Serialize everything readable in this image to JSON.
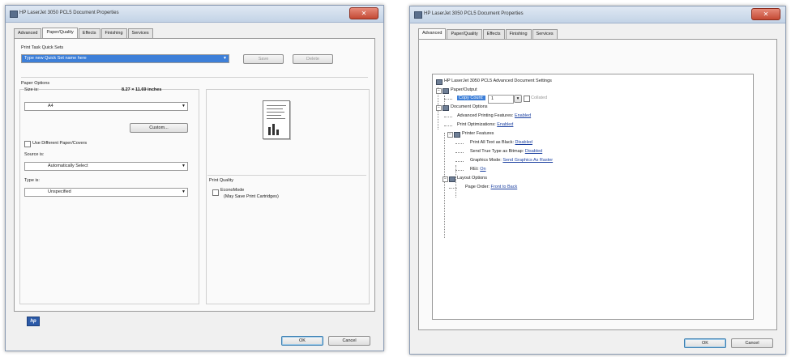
{
  "left_window": {
    "title": "HP LaserJet 3050 PCL5 Document Properties",
    "close_glyph": "✕",
    "tabs": [
      "Advanced",
      "Paper/Quality",
      "Effects",
      "Finishing",
      "Services"
    ],
    "active_tab": "Paper/Quality",
    "print_task_quick_sets": {
      "label": "Print Task Quick Sets",
      "value": "Type new Quick Set name here",
      "save_label": "Save",
      "delete_label": "Delete"
    },
    "paper_options": {
      "label": "Paper Options",
      "size_label": "Size is:",
      "size_value": "8.27 × 11.69 inches",
      "size_selected": "A4",
      "custom_label": "Custom...",
      "different_paper_label": "Use Different Paper/Covers",
      "source_label": "Source is:",
      "source_value": "Automatically Select",
      "type_label": "Type is:",
      "type_value": "Unspecified"
    },
    "print_quality": {
      "label": "Print Quality",
      "economode_label": "EconoMode",
      "economode_note": "(May Save Print Cartridges)"
    },
    "logo_text": "hp",
    "ok_label": "OK",
    "cancel_label": "Cancel"
  },
  "right_window": {
    "title": "HP LaserJet 3050 PCL5 Document Properties",
    "close_glyph": "✕",
    "tabs": [
      "Advanced",
      "Paper/Quality",
      "Effects",
      "Finishing",
      "Services"
    ],
    "active_tab": "Advanced",
    "tree": {
      "root": "HP LaserJet 3050 PCL5 Advanced Document Settings",
      "paper_output": "Paper/Output",
      "copy_count_label": "Copy Count:",
      "copy_count_value": "1",
      "collated_label": "Collated",
      "document_options": "Document Options",
      "advanced_printing_label": "Advanced Printing Features:",
      "advanced_printing_value": "Enabled",
      "print_optimizations_label": "Print Optimizations:",
      "print_optimizations_value": "Enabled",
      "printer_features": "Printer Features",
      "print_all_text_label": "Print All Text as Black:",
      "print_all_text_value": "Disabled",
      "send_truetype_label": "Send True Type as Bitmap:",
      "send_truetype_value": "Disabled",
      "graphics_mode_label": "Graphics Mode:",
      "graphics_mode_value": "Send Graphics As Raster",
      "ret_label": "REt:",
      "ret_value": "On",
      "layout_options": "Layout Options",
      "page_order_label": "Page Order:",
      "page_order_value": "Front to Back"
    },
    "ok_label": "OK",
    "cancel_label": "Cancel"
  }
}
